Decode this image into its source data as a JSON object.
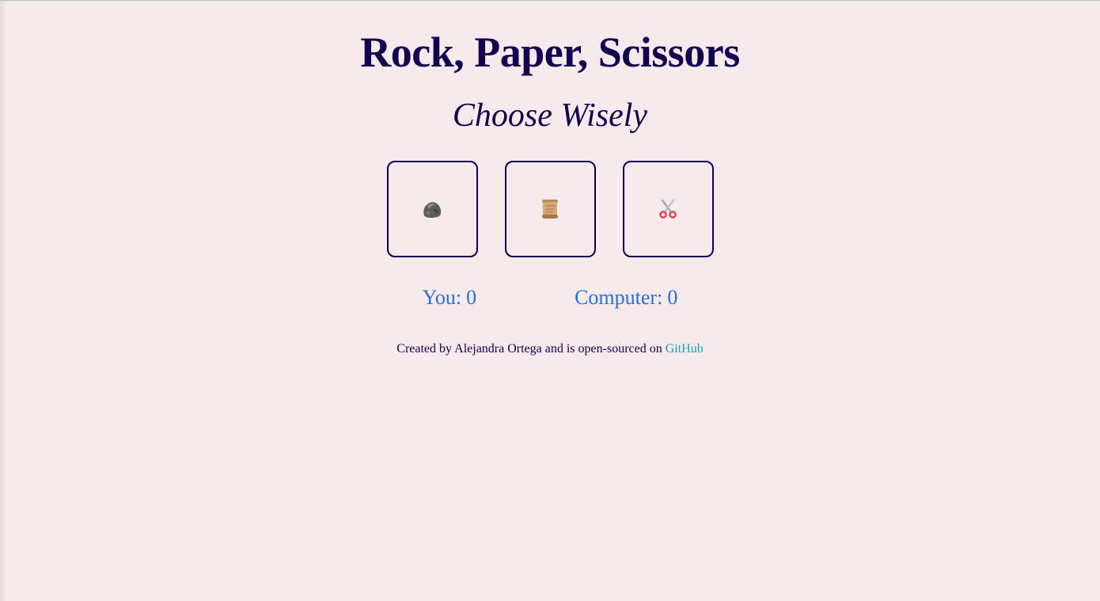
{
  "header": {
    "title": "Rock, Paper, Scissors",
    "subtitle": "Choose Wisely"
  },
  "choices": [
    {
      "name": "rock",
      "icon": "rock-icon"
    },
    {
      "name": "paper",
      "icon": "scroll-icon"
    },
    {
      "name": "scissors",
      "icon": "scissors-icon"
    }
  ],
  "scores": {
    "you_label": "You:",
    "you_value": "0",
    "computer_label": "Computer:",
    "computer_value": "0"
  },
  "footer": {
    "text": "Created by Alejandra Ortega and is open-sourced on",
    "link_text": "GitHub"
  },
  "colors": {
    "background": "#f6eaec",
    "primary": "#12004f",
    "score": "#2a6fd6",
    "link": "#12a7b8"
  }
}
